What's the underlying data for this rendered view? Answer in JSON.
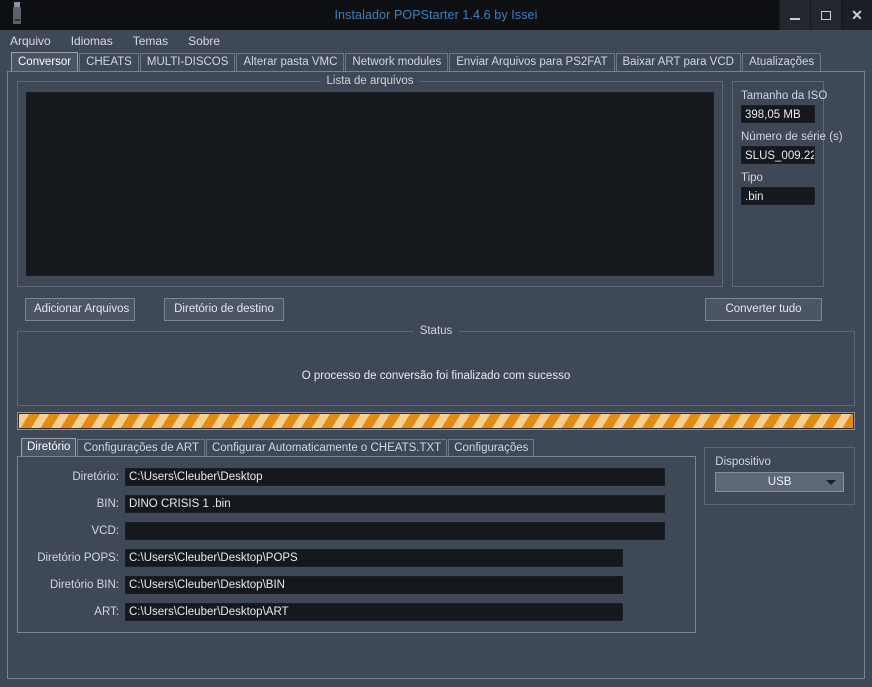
{
  "titlebar": {
    "icon": "usb-drive-icon",
    "title": "Instalador POPStarter 1.4.6  by Issei",
    "minimize": "_",
    "maximize": "□",
    "close": "✕"
  },
  "menubar": {
    "items": [
      {
        "label": "Arquivo"
      },
      {
        "label": "Idiomas"
      },
      {
        "label": "Temas"
      },
      {
        "label": "Sobre"
      }
    ]
  },
  "main_tabs": {
    "active_index": 0,
    "items": [
      {
        "label": "Conversor"
      },
      {
        "label": "CHEATS"
      },
      {
        "label": "MULTI-DISCOS"
      },
      {
        "label": "Alterar pasta VMC"
      },
      {
        "label": "Network modules"
      },
      {
        "label": "Enviar Arquivos para PS2FAT"
      },
      {
        "label": "Baixar ART para VCD"
      },
      {
        "label": "Atualizações"
      }
    ]
  },
  "files_group": {
    "title": "Lista de arquivos",
    "items": []
  },
  "iso_info": {
    "size_label": "Tamanho da ISO",
    "size_value": "398,05 MB",
    "serial_label": "Número de série (s)",
    "serial_value": "SLUS_009.22",
    "type_label": "Tipo",
    "type_value": ".bin"
  },
  "buttons": {
    "add_files": "Adicionar Arquivos",
    "destination_dir": "Diretório de destino",
    "convert_all": "Converter tudo"
  },
  "status": {
    "title": "Status",
    "message": "O processo de conversão foi finalizado com sucesso",
    "progress_percent": 100
  },
  "sub_tabs": {
    "active_index": 0,
    "items": [
      {
        "label": "Diretório"
      },
      {
        "label": "Configurações de ART"
      },
      {
        "label": "Configurar Automaticamente o CHEATS.TXT"
      },
      {
        "label": "Configurações"
      }
    ]
  },
  "directory_form": {
    "rows": [
      {
        "label": "Diretório:",
        "value": "C:\\Users\\Cleuber\\Desktop",
        "width": "w1"
      },
      {
        "label": "BIN:",
        "value": "DINO CRISIS 1 .bin",
        "width": "w1"
      },
      {
        "label": "VCD:",
        "value": "",
        "width": "w1"
      },
      {
        "label": "Diretório POPS:",
        "value": "C:\\Users\\Cleuber\\Desktop\\POPS",
        "width": "w2"
      },
      {
        "label": "Diretório BIN:",
        "value": "C:\\Users\\Cleuber\\Desktop\\BIN",
        "width": "w2"
      },
      {
        "label": "ART:",
        "value": "C:\\Users\\Cleuber\\Desktop\\ART",
        "width": "w2"
      }
    ]
  },
  "device": {
    "label": "Dispositivo",
    "selected": "USB",
    "options": [
      "USB"
    ]
  },
  "colors": {
    "window_bg": "#3e4856",
    "titlebar_bg": "#0d0f13",
    "title_text": "#3f7fbf",
    "input_bg": "#15181d",
    "progress_orange": "#e28b12",
    "progress_light": "#f6cf95"
  }
}
